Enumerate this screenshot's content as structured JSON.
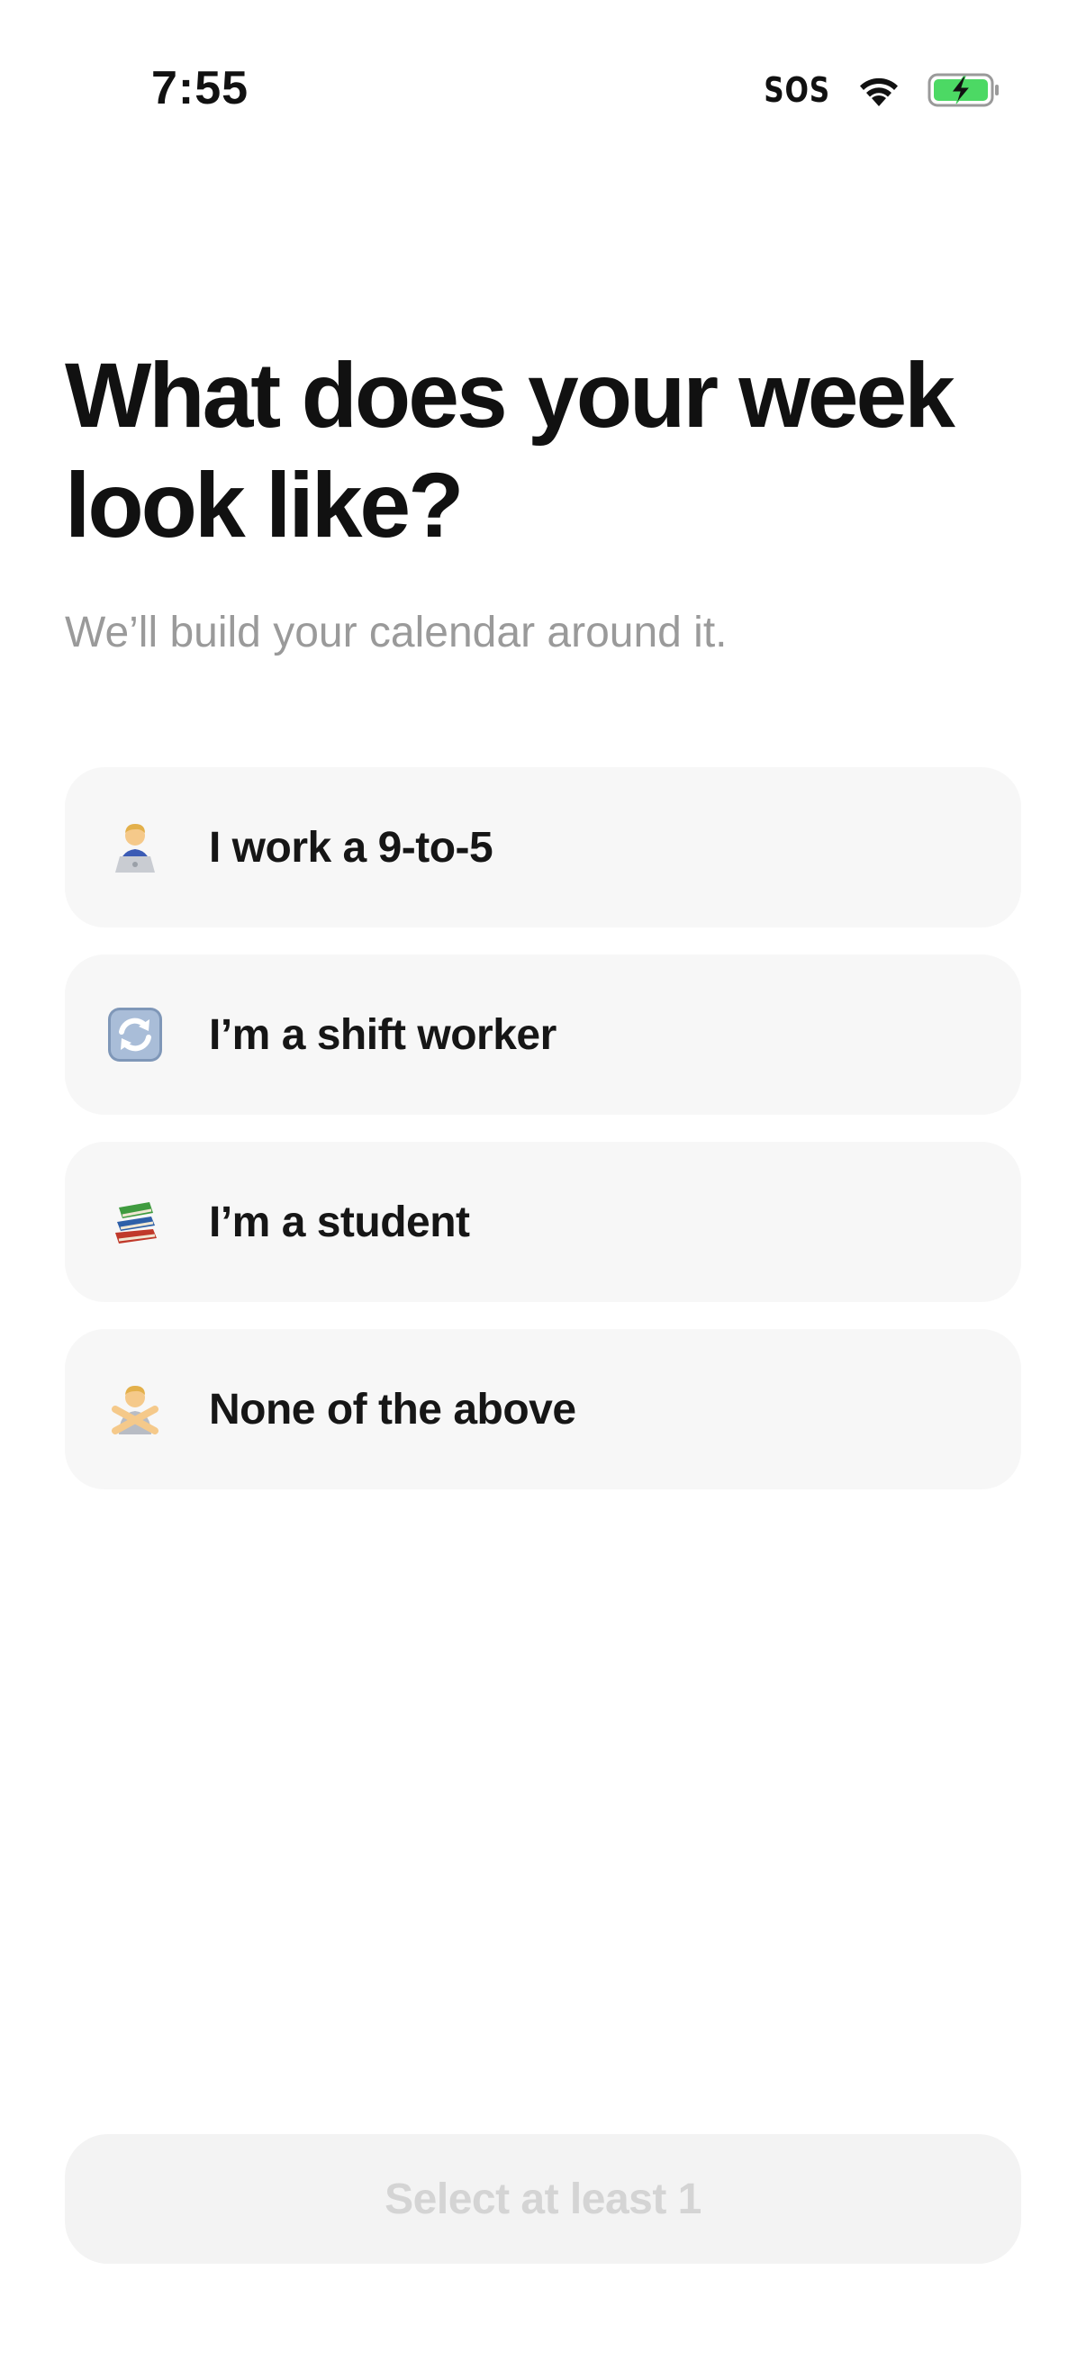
{
  "status_bar": {
    "time": "7:55",
    "carrier_status": "SOS",
    "wifi_icon": "wifi-icon",
    "battery_icon": "battery-charging-icon",
    "battery_color": "#4cd964"
  },
  "header": {
    "title": "What does your week look like?",
    "subtitle": "We’ll build your calendar around it."
  },
  "options": [
    {
      "icon": "person-at-laptop-icon",
      "label": "I work a 9-to-5"
    },
    {
      "icon": "rotating-arrows-icon",
      "label": "I’m a shift worker"
    },
    {
      "icon": "books-icon",
      "label": "I’m a student"
    },
    {
      "icon": "person-crossed-arms-icon",
      "label": "None of the above"
    }
  ],
  "footer": {
    "button_label": "Select at least 1",
    "button_enabled": false
  },
  "colors": {
    "background": "#ffffff",
    "card_background": "#f7f7f7",
    "title_text": "#111111",
    "subtitle_text": "#9a9a9a",
    "disabled_button_background": "#f3f3f3",
    "disabled_button_text": "#d4d4d4"
  }
}
